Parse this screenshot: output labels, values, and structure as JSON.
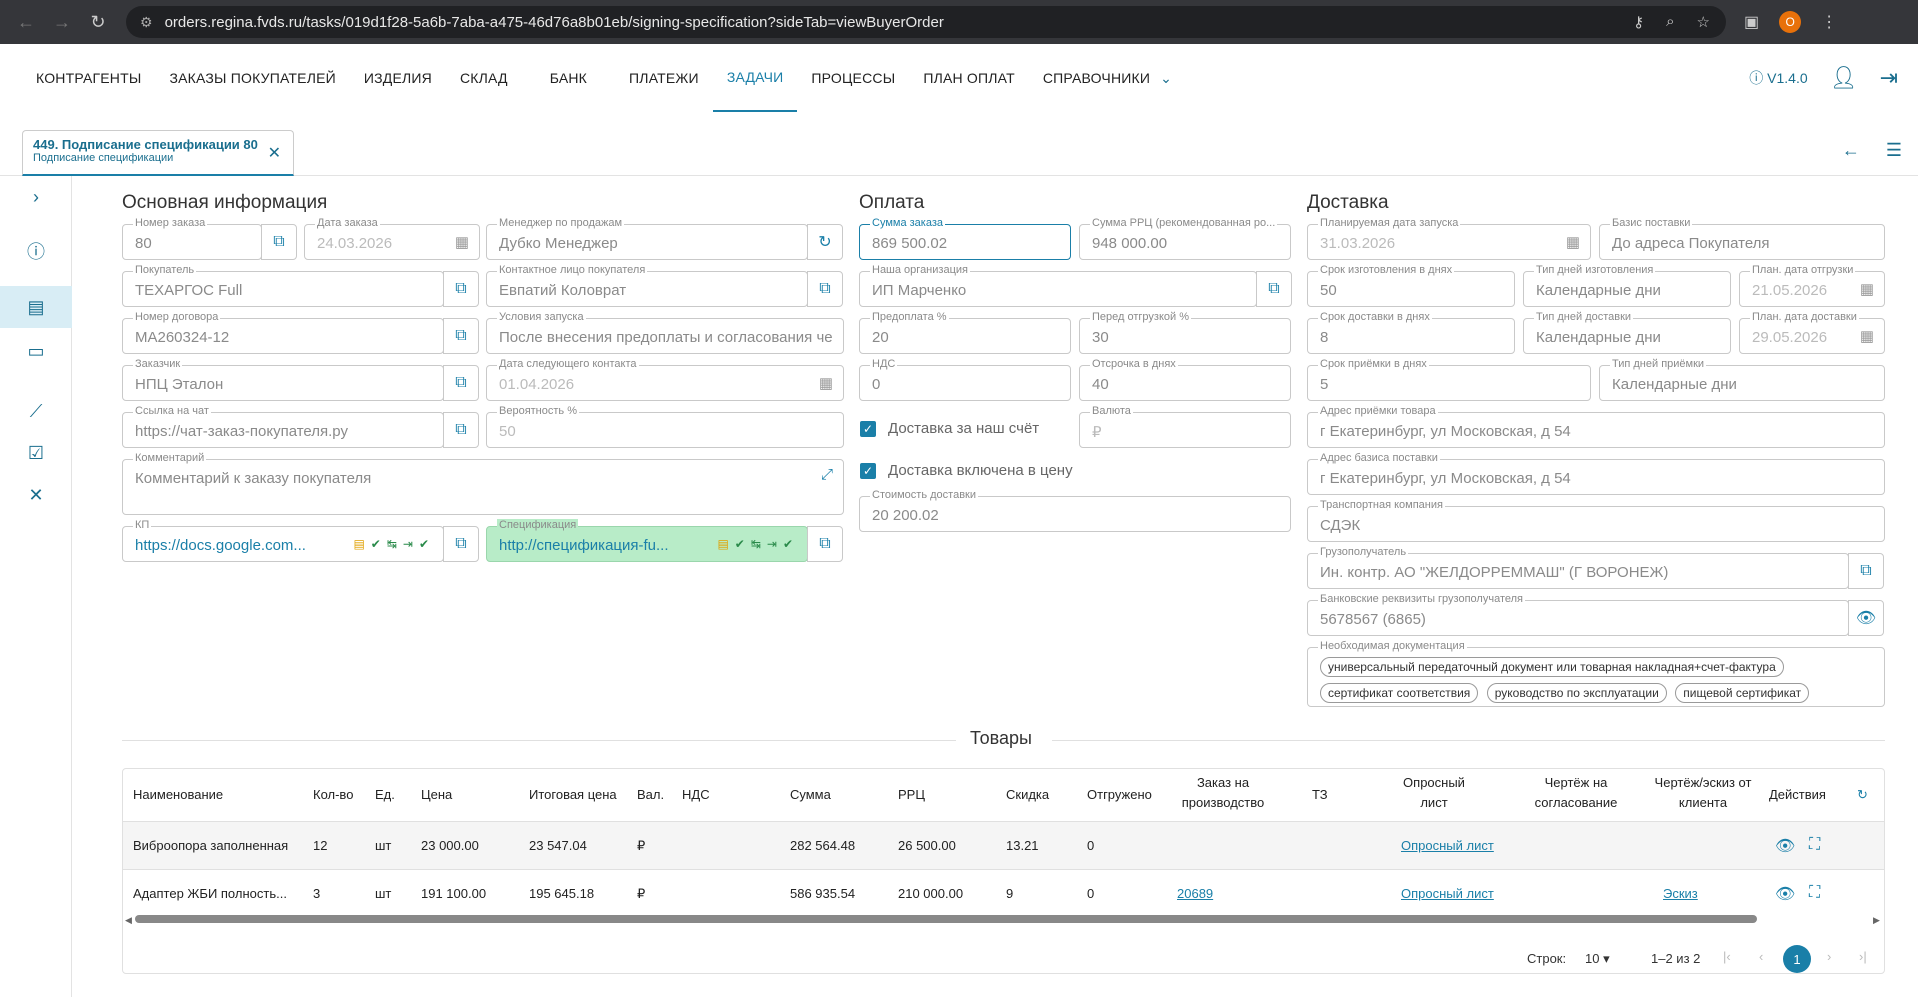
{
  "browser": {
    "url": "orders.regina.fvds.ru/tasks/019d1f28-5a6b-7aba-a475-46d76a8b01eb/signing-specification?sideTab=viewBuyerOrder",
    "profile": "O"
  },
  "nav": {
    "items": [
      "КОНТРАГЕНТЫ",
      "ЗАКАЗЫ ПОКУПАТЕЛЕЙ",
      "ИЗДЕЛИЯ",
      "СКЛАД",
      "БАНК",
      "ПЛАТЕЖИ",
      "ЗАДАЧИ",
      "ПРОЦЕССЫ",
      "ПЛАН ОПЛАТ",
      "СПРАВОЧНИКИ"
    ],
    "active": "ЗАДАЧИ",
    "version": "V1.4.0"
  },
  "tab": {
    "title": "449. Подписание спецификации 80",
    "subtitle": "Подписание спецификации"
  },
  "main": {
    "title": "Основная информация",
    "order_no": {
      "label": "Номер заказа",
      "value": "80"
    },
    "order_date": {
      "label": "Дата заказа",
      "value": "24.03.2026"
    },
    "manager": {
      "label": "Менеджер по продажам",
      "value": "Дубко Менеджер"
    },
    "buyer": {
      "label": "Покупатель",
      "value": "ТЕХАРГОС Full"
    },
    "contact": {
      "label": "Контактное лицо покупателя",
      "value": "Евпатий Коловрат"
    },
    "contract": {
      "label": "Номер договора",
      "value": "МА260324-12"
    },
    "launch_cond": {
      "label": "Условия запуска",
      "value": "После внесения предоплаты и согласования чертежа"
    },
    "customer": {
      "label": "Заказчик",
      "value": "НПЦ Эталон"
    },
    "next_contact": {
      "label": "Дата следующего контакта",
      "value": "01.04.2026"
    },
    "chat": {
      "label": "Ссылка на чат",
      "value": "https://чат-заказ-покупателя.ру"
    },
    "probability": {
      "label": "Вероятность %",
      "value": "50"
    },
    "comment": {
      "label": "Комментарий",
      "value": "Комментарий к заказу покупателя"
    },
    "kp": {
      "label": "КП",
      "value": "https://docs.google.com..."
    },
    "spec": {
      "label": "Спецификация",
      "value": "http://спецификация-fu..."
    }
  },
  "payment": {
    "title": "Оплата",
    "order_sum": {
      "label": "Сумма заказа",
      "value": "869 500.02"
    },
    "rrc_sum": {
      "label": "Сумма РРЦ (рекомендованная ро...",
      "value": "948 000.00"
    },
    "org": {
      "label": "Наша организация",
      "value": "ИП Марченко"
    },
    "prepay": {
      "label": "Предоплата %",
      "value": "20"
    },
    "before_ship": {
      "label": "Перед отгрузкой %",
      "value": "30"
    },
    "vat": {
      "label": "НДС",
      "value": "0"
    },
    "delay": {
      "label": "Отсрочка в днях",
      "value": "40"
    },
    "currency": {
      "label": "Валюта",
      "value": "₽"
    },
    "chk1": "Доставка за наш счёт",
    "chk2": "Доставка включена в цену",
    "delivery_cost": {
      "label": "Стоимость доставки",
      "value": "20 200.02"
    }
  },
  "delivery": {
    "title": "Доставка",
    "launch_date": {
      "label": "Планируемая дата запуска",
      "value": "31.03.2026"
    },
    "basis": {
      "label": "Базис поставки",
      "value": "До адреса Покупателя"
    },
    "make_days": {
      "label": "Срок изготовления в днях",
      "value": "50"
    },
    "make_type": {
      "label": "Тип дней изготовления",
      "value": "Календарные дни"
    },
    "ship_date": {
      "label": "План. дата отгрузки",
      "value": "21.05.2026"
    },
    "deliv_days": {
      "label": "Срок доставки в днях",
      "value": "8"
    },
    "deliv_type": {
      "label": "Тип дней доставки",
      "value": "Календарные дни"
    },
    "deliv_date": {
      "label": "План. дата доставки",
      "value": "29.05.2026"
    },
    "accept_days": {
      "label": "Срок приёмки в днях",
      "value": "5"
    },
    "accept_type": {
      "label": "Тип дней приёмки",
      "value": "Календарные дни"
    },
    "accept_addr": {
      "label": "Адрес приёмки товара",
      "value": "г Екатеринбург, ул Московская, д 54"
    },
    "basis_addr": {
      "label": "Адрес базиса поставки",
      "value": "г Екатеринбург, ул Московская, д 54"
    },
    "transport": {
      "label": "Транспортная компания",
      "value": "СДЭК"
    },
    "consignee": {
      "label": "Грузополучатель",
      "value": "Ин. контр. АО \"ЖЕЛДОРРЕММАШ\" (Г ВОРОНЕЖ)"
    },
    "bank": {
      "label": "Банковские реквизиты грузополучателя",
      "value": "5678567 (6865)"
    },
    "docs_label": "Необходимая документация",
    "docs": [
      "универсальный передаточный документ или товарная накладная+счет-фактура",
      "сертификат соответствия",
      "руководство по эксплуатации",
      "пищевой сертификат"
    ]
  },
  "goods": {
    "title": "Товары",
    "headers": [
      "Наименование",
      "Кол-во",
      "Ед.",
      "Цена",
      "Итоговая цена",
      "Вал.",
      "НДС",
      "Сумма",
      "РРЦ",
      "Скидка",
      "Отгружено",
      "Заказ на производство",
      "ТЗ",
      "Опросный лист",
      "Чертёж на согласование",
      "Чертёж/эскиз от клиента",
      "Действия"
    ],
    "rows": [
      {
        "name": "Виброопора заполненная",
        "qty": "12",
        "unit": "шт",
        "price": "23 000.00",
        "final": "23 547.04",
        "cur": "₽",
        "sum": "282 564.48",
        "rrc": "26 500.00",
        "disc": "13.21",
        "shipped": "0",
        "prod": "",
        "survey": "Опросный лист",
        "sketch": ""
      },
      {
        "name": "Адаптер ЖБИ полность...",
        "qty": "3",
        "unit": "шт",
        "price": "191 100.00",
        "final": "195 645.18",
        "cur": "₽",
        "sum": "586 935.54",
        "rrc": "210 000.00",
        "disc": "9",
        "shipped": "0",
        "prod": "20689",
        "survey": "Опросный лист",
        "sketch": "Эскиз"
      }
    ],
    "rows_label": "Строк:",
    "rows_per_page": "10",
    "range": "1–2 из 2",
    "page": "1"
  }
}
